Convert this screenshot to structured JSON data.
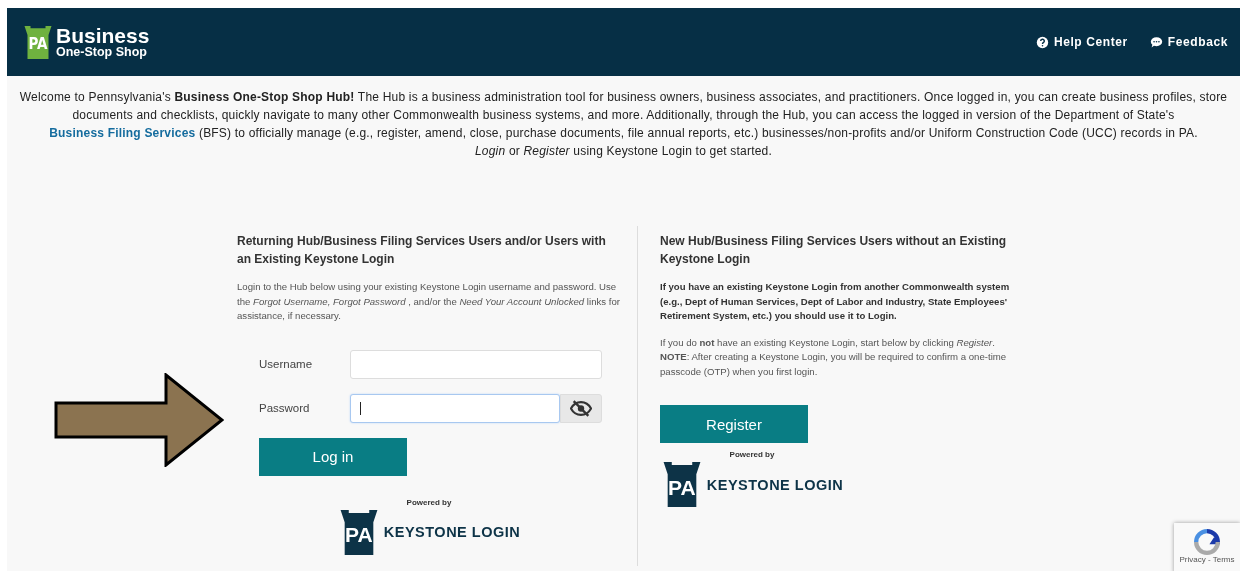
{
  "header": {
    "logo_badge": "PA",
    "logo_title": "Business",
    "logo_subtitle": "One-Stop Shop",
    "links": [
      {
        "kind": "help",
        "label": "Help Center"
      },
      {
        "kind": "feedback",
        "label": "Feedback"
      }
    ]
  },
  "intro": {
    "before": "Welcome to Pennsylvania's **Business One-Stop Shop Hub!**  The Hub is a business administration tool for business owners, business associates, and practitioners.  Once logged in, you can create business profiles, store documents and checklists, quickly navigate to many other Commonwealth business systems, and more.  Additionally, through the Hub, you can access the logged in version of the Department of State's",
    "link": "Business Filing Services",
    "after": "(BFS) to officially manage (e.g., register, amend, close, purchase documents, file annual reports, etc.) businesses/non-profits and/or Uniform Construction Code (UCC) records in PA.",
    "last": "*Login* or *Register* using Keystone Login to get started."
  },
  "login": {
    "heading": "Returning Hub/Business Filing Services Users and/or Users with an Existing Keystone Login",
    "text": "Login to the Hub below using your existing Keystone Login username and password. Use the *Forgot Username, Forgot Password* , and/or the *Need Your Account Unlocked* links for assistance, if necessary.",
    "fields": [
      {
        "label": "Username",
        "kind": "text",
        "focused": false
      },
      {
        "label": "Password",
        "kind": "password",
        "focused": true
      }
    ],
    "button": "Log in",
    "powered": "Powered by",
    "brand_badge": "PA",
    "brand": "KEYSTONE LOGIN"
  },
  "register": {
    "heading": "New Hub/Business Filing Services Users without an Existing Keystone Login",
    "bold_text": "If you have an existing Keystone Login from another Commonwealth system (e.g., Dept of Human Services, Dept of Labor and Industry, State Employees' Retirement System, etc.) you should use it to Login.",
    "text": "If you do **not** have an existing Keystone Login, start below by clicking *Register*. **NOTE**: After creating a Keystone Login, you will be required to confirm a one-time passcode (OTP) when you first login.",
    "button": "Register",
    "powered": "Powered by",
    "brand_badge": "PA",
    "brand": "KEYSTONE LOGIN"
  },
  "recaptcha": {
    "links": "Privacy - Terms"
  }
}
